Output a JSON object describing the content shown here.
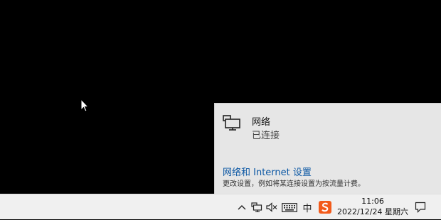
{
  "flyout": {
    "network": {
      "name": "网络",
      "status": "已连接",
      "icon": "ethernet-monitor-icon"
    },
    "settings_link": "网络和 Internet 设置",
    "settings_desc": "更改设置，例如将某连接设置为按流量计费。"
  },
  "taskbar": {
    "tray": {
      "overflow_icon": "chevron-up-icon",
      "network_icon": "network-icon",
      "volume_icon": "volume-muted-icon",
      "keyboard_icon": "keyboard-icon",
      "ime_label": "中",
      "sogou_icon": "sogou-s-icon"
    },
    "clock": {
      "time": "11:06",
      "date": "2022/12/24 星期六"
    },
    "notification_icon": "action-center-icon"
  },
  "colors": {
    "link": "#0b57a4",
    "flyout_bg": "#e6e6e6",
    "taskbar_bg": "#f0f0f0",
    "sogou": "#f25a1a"
  }
}
